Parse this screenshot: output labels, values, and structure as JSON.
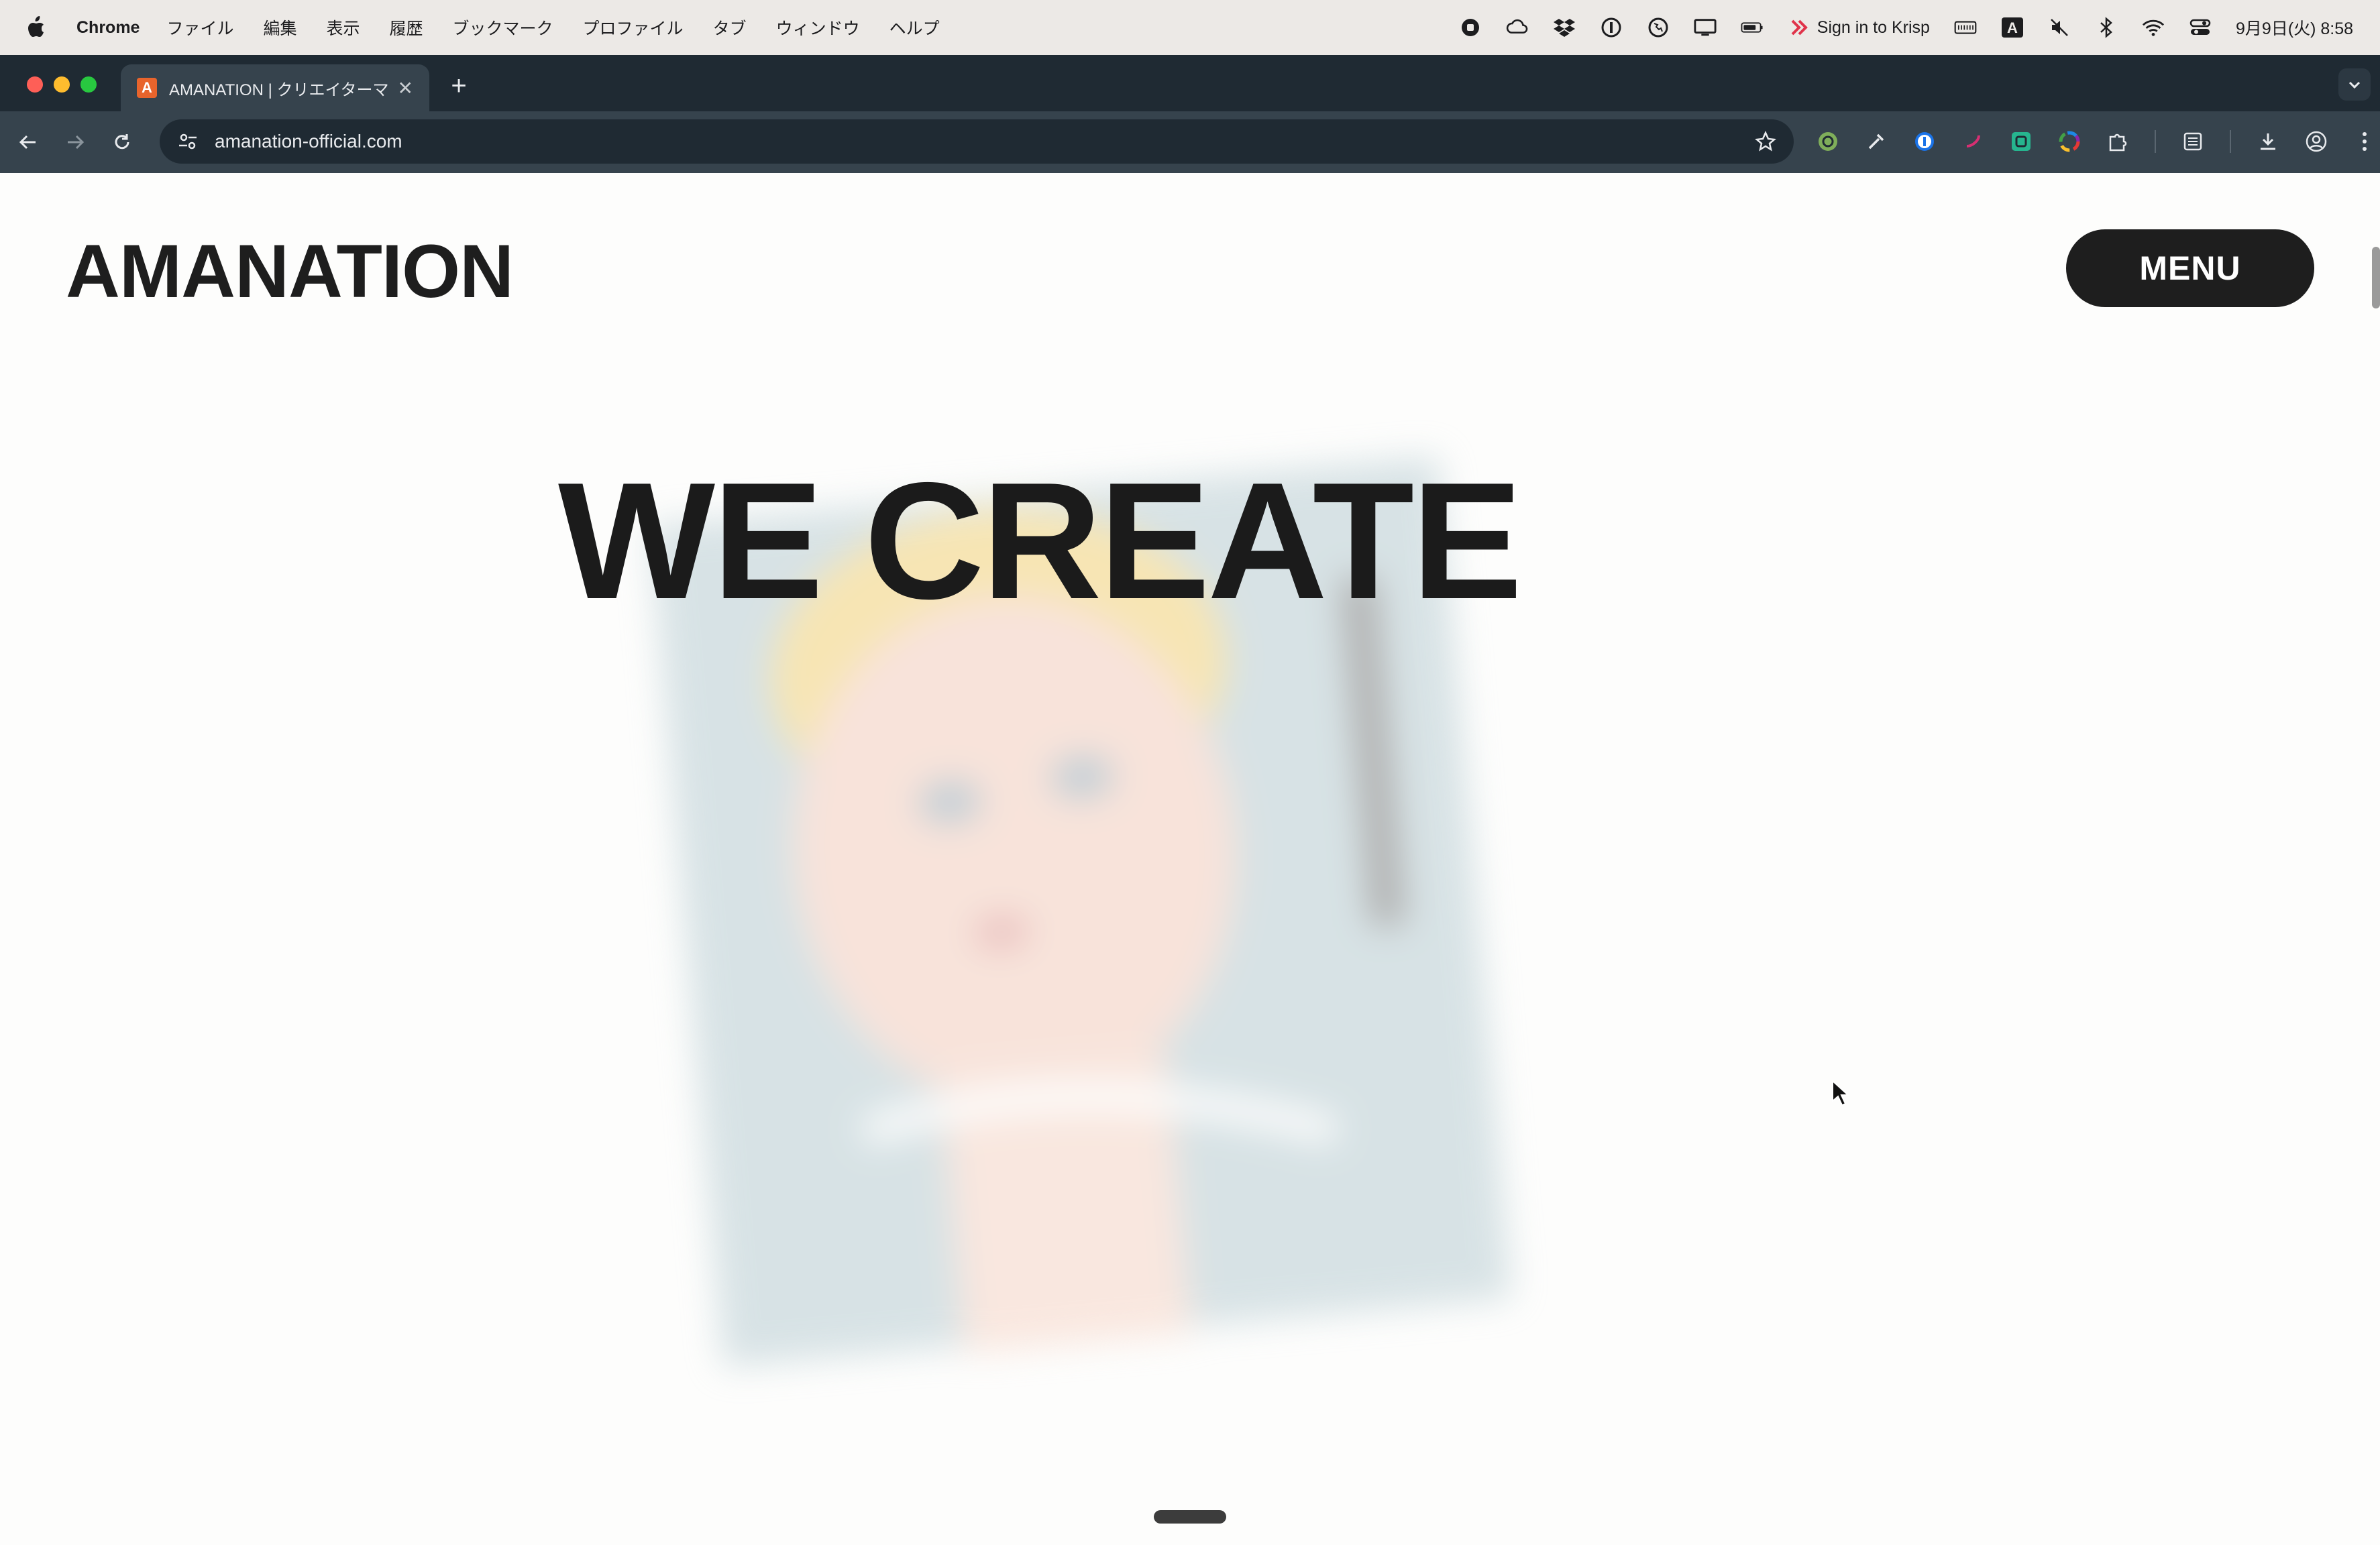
{
  "menubar": {
    "app_name": "Chrome",
    "items": [
      "ファイル",
      "編集",
      "表示",
      "履歴",
      "ブックマーク",
      "プロファイル",
      "タブ",
      "ウィンドウ",
      "ヘルプ"
    ],
    "krisp_label": "Sign in to Krisp",
    "clock": "9月9日(火)  8:58"
  },
  "browser": {
    "tab_title": "AMANATION | クリエイターマネ",
    "url": "amanation-official.com"
  },
  "site": {
    "logo": "AMANATION",
    "menu_label": "MENU",
    "hero_title": "WE CREATE"
  },
  "colors": {
    "tab_favicon": "#e8642c",
    "menu_button": "#1e1e1e",
    "text_dark": "#1b1b1b"
  }
}
